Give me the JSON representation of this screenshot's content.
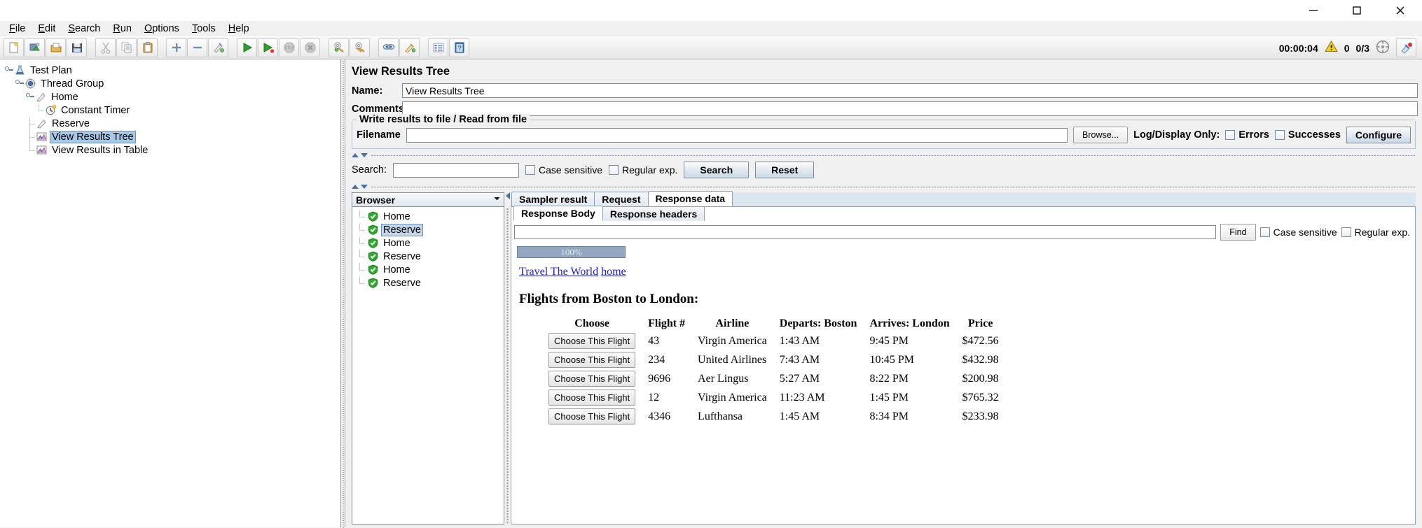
{
  "window": {
    "minimize_label": "Minimize",
    "maximize_label": "Maximize",
    "close_label": "Close"
  },
  "menubar": {
    "items": [
      {
        "label": "File",
        "mnemonic": "F"
      },
      {
        "label": "Edit",
        "mnemonic": "E"
      },
      {
        "label": "Search",
        "mnemonic": "S"
      },
      {
        "label": "Run",
        "mnemonic": "R"
      },
      {
        "label": "Options",
        "mnemonic": "O"
      },
      {
        "label": "Tools",
        "mnemonic": "T"
      },
      {
        "label": "Help",
        "mnemonic": "H"
      }
    ]
  },
  "toolbar": {
    "buttons": [
      {
        "name": "new-test-plan-icon",
        "title": "New"
      },
      {
        "name": "templates-icon",
        "title": "Templates"
      },
      {
        "name": "open-icon",
        "title": "Open"
      },
      {
        "name": "save-icon",
        "title": "Save"
      },
      {
        "name": "cut-icon",
        "title": "Cut"
      },
      {
        "name": "copy-icon",
        "title": "Copy"
      },
      {
        "name": "paste-icon",
        "title": "Paste"
      },
      {
        "name": "expand-all-icon",
        "title": "Expand All"
      },
      {
        "name": "collapse-all-icon",
        "title": "Collapse All"
      },
      {
        "name": "toggle-icon",
        "title": "Toggle"
      },
      {
        "name": "start-icon",
        "title": "Start"
      },
      {
        "name": "start-no-pauses-icon",
        "title": "Start no pauses"
      },
      {
        "name": "stop-icon",
        "title": "Stop"
      },
      {
        "name": "shutdown-icon",
        "title": "Shutdown"
      },
      {
        "name": "clear-icon",
        "title": "Clear"
      },
      {
        "name": "clear-all-icon",
        "title": "Clear All"
      },
      {
        "name": "search-icon",
        "title": "Search"
      },
      {
        "name": "search-reset-icon",
        "title": "Reset Search"
      },
      {
        "name": "function-helper-icon",
        "title": "Function Helper Dialog"
      },
      {
        "name": "help-icon",
        "title": "Help"
      }
    ],
    "status": {
      "elapsed": "00:00:04",
      "warning_count": "0",
      "threads": "0/3",
      "remote_label": "remote",
      "warning_icon": "warning-triangle-icon",
      "threads_icon": "threads-gauge-icon",
      "error_icon": "error-indicator-icon"
    }
  },
  "tree": {
    "nodes": [
      {
        "label": "Test Plan",
        "icon": "test-plan-icon",
        "depth": 0,
        "selected": false,
        "expanded": true
      },
      {
        "label": "Thread Group",
        "icon": "thread-group-icon",
        "depth": 1,
        "selected": false,
        "expanded": true
      },
      {
        "label": "Home",
        "icon": "http-sampler-icon",
        "depth": 2,
        "selected": false,
        "expanded": true
      },
      {
        "label": "Constant Timer",
        "icon": "timer-icon",
        "depth": 3,
        "selected": false,
        "expanded": false
      },
      {
        "label": "Reserve",
        "icon": "http-sampler-icon",
        "depth": 2,
        "selected": false,
        "expanded": false
      },
      {
        "label": "View Results Tree",
        "icon": "listener-icon",
        "depth": 2,
        "selected": true,
        "expanded": false
      },
      {
        "label": "View Results in Table",
        "icon": "listener-icon",
        "depth": 2,
        "selected": false,
        "expanded": false
      }
    ]
  },
  "panel": {
    "title": "View Results Tree",
    "name_label": "Name:",
    "name_value": "View Results Tree",
    "comments_label": "Comments:",
    "comments_value": "",
    "file_group_label": "Write results to file / Read from file",
    "filename_label": "Filename",
    "filename_value": "",
    "browse_label": "Browse...",
    "log_display_label": "Log/Display Only:",
    "errors_label": "Errors",
    "errors_checked": false,
    "successes_label": "Successes",
    "successes_checked": false,
    "configure_label": "Configure"
  },
  "search": {
    "label": "Search:",
    "value": "",
    "case_sensitive_label": "Case sensitive",
    "case_sensitive_checked": false,
    "regex_label": "Regular exp.",
    "regex_checked": false,
    "search_button": "Search",
    "reset_button": "Reset"
  },
  "browser_panel": {
    "title": "Browser",
    "dropdown_icon": "chevron-down-icon",
    "items": [
      {
        "label": "Home",
        "status": "success",
        "selected": false
      },
      {
        "label": "Reserve",
        "status": "success",
        "selected": true
      },
      {
        "label": "Home",
        "status": "success",
        "selected": false
      },
      {
        "label": "Reserve",
        "status": "success",
        "selected": false
      },
      {
        "label": "Home",
        "status": "success",
        "selected": false
      },
      {
        "label": "Reserve",
        "status": "success",
        "selected": false
      }
    ]
  },
  "result_tabs": {
    "main": [
      {
        "label": "Sampler result",
        "active": false
      },
      {
        "label": "Request",
        "active": false
      },
      {
        "label": "Response data",
        "active": true
      }
    ],
    "sub": [
      {
        "label": "Response Body",
        "active": true
      },
      {
        "label": "Response headers",
        "active": false
      }
    ]
  },
  "find": {
    "value": "",
    "find_label": "Find",
    "case_sensitive_label": "Case sensitive",
    "case_sensitive_checked": false,
    "regex_label": "Regular exp.",
    "regex_checked": false
  },
  "response": {
    "progress_label": "100%",
    "links": [
      {
        "text": "Travel The World"
      },
      {
        "text": "home"
      }
    ],
    "heading": "Flights from Boston to London:",
    "table": {
      "headers": [
        "Choose",
        "Flight #",
        "Airline",
        "Departs: Boston",
        "Arrives: London",
        "Price"
      ],
      "button_label": "Choose This Flight",
      "rows": [
        {
          "flight": "43",
          "airline": "Virgin America",
          "departs": "1:43 AM",
          "arrives": "9:45 PM",
          "price": "$472.56"
        },
        {
          "flight": "234",
          "airline": "United Airlines",
          "departs": "7:43 AM",
          "arrives": "10:45 PM",
          "price": "$432.98"
        },
        {
          "flight": "9696",
          "airline": "Aer Lingus",
          "departs": "5:27 AM",
          "arrives": "8:22 PM",
          "price": "$200.98"
        },
        {
          "flight": "12",
          "airline": "Virgin America",
          "departs": "11:23 AM",
          "arrives": "1:45 PM",
          "price": "$765.32"
        },
        {
          "flight": "4346",
          "airline": "Lufthansa",
          "departs": "1:45 AM",
          "arrives": "8:34 PM",
          "price": "$233.98"
        }
      ]
    }
  },
  "colors": {
    "accent": "#a8c8e8",
    "link": "#2020c8",
    "success_green": "#2faa2f",
    "warning_yellow": "#f5d020",
    "progress_bar": "#92a7c0"
  }
}
